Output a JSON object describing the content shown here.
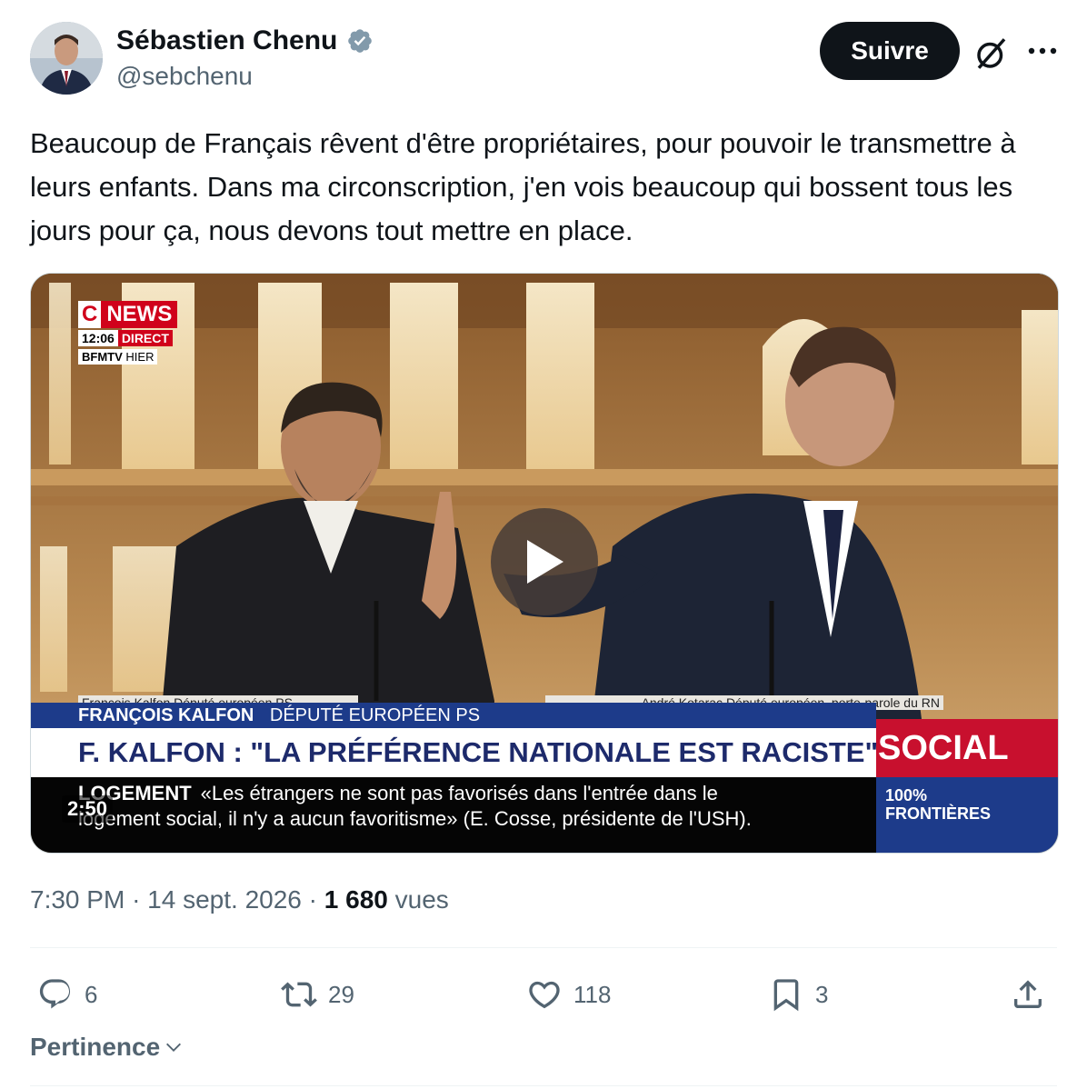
{
  "author": {
    "name": "Sébastien Chenu",
    "handle": "@sebchenu"
  },
  "header": {
    "follow_label": "Suivre"
  },
  "tweet": {
    "text": "Beaucoup de Français rêvent d'être propriétaires, pour pouvoir le transmettre à leurs enfants. Dans ma circonscription, j'en vois beaucoup qui bossent tous les jours pour ça, nous devons tout mettre en place."
  },
  "video": {
    "duration": "2:50",
    "channel_c": "C",
    "channel_news": "NEWS",
    "clock": "12:06",
    "live": "DIRECT",
    "source": "BFMTV",
    "source_when": "HIER",
    "speaker_left_tag": "François Kalfon  Député européen PS",
    "speaker_right_tag": "André Kotarac  Député européen, porte-parole du RN",
    "name_bar_name": "FRANÇOIS KALFON",
    "name_bar_role": "DÉPUTÉ EUROPÉEN PS",
    "headline": "F. KALFON : \"LA PRÉFÉRENCE NATIONALE EST RACISTE\"",
    "ticker_label": "LOGEMENT",
    "ticker_line1": "«Les étrangers ne sont pas favorisés dans l'entrée dans le",
    "ticker_line2": "logement social, il n'y a aucun favoritisme» (E. Cosse, présidente de l'USH).",
    "side_red": "SOCIAL",
    "side_blue_line1": "100%",
    "side_blue_line2": "FRONTIÈRES"
  },
  "meta": {
    "time": "7:30 PM",
    "date": "14 sept. 2026",
    "views_count": "1 680",
    "views_label": "vues"
  },
  "actions": {
    "replies": "6",
    "reposts": "29",
    "likes": "118",
    "bookmarks": "3"
  },
  "sort": {
    "label": "Pertinence"
  },
  "colors": {
    "text_primary": "#0f1419",
    "text_secondary": "#536471",
    "verified": "#829aab",
    "follow_bg": "#0f1419"
  },
  "icons": [
    "verified-badge-icon",
    "grok-icon",
    "more-icon",
    "play-icon",
    "reply-icon",
    "repost-icon",
    "like-icon",
    "bookmark-icon",
    "share-icon",
    "chevron-down-icon"
  ]
}
